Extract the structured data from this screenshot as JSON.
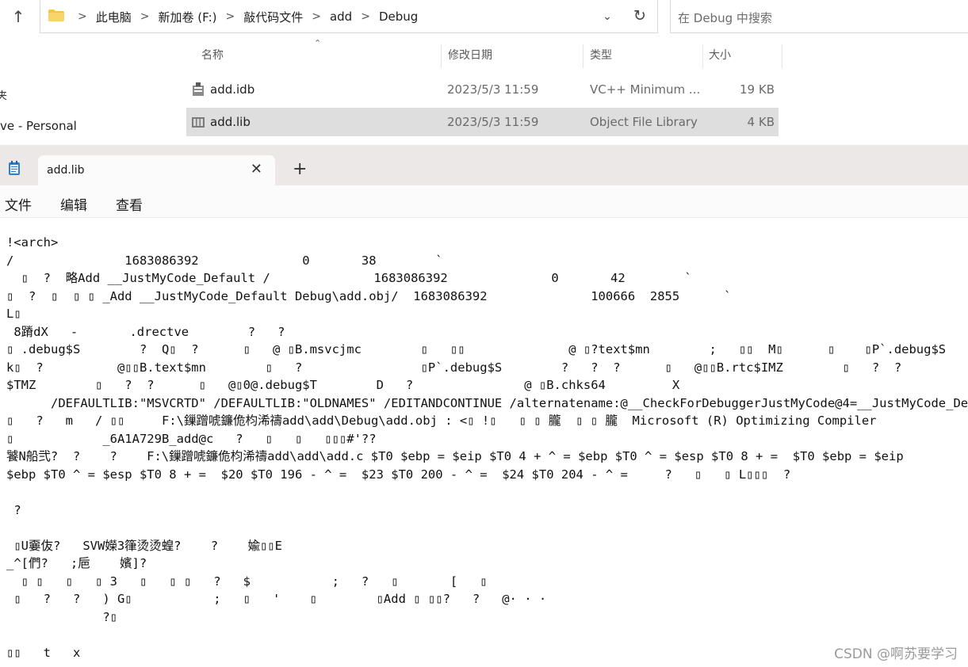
{
  "explorer": {
    "address": {
      "crumbs": [
        "此电脑",
        "新加卷 (F:)",
        "敲代码文件",
        "add",
        "Debug"
      ],
      "separator": ">"
    },
    "search_placeholder": "在 Debug 中搜索",
    "nav": {
      "fragment": "夹",
      "onedrive": "ve - Personal"
    },
    "columns": {
      "name": "名称",
      "date": "修改日期",
      "type": "类型",
      "size": "大小"
    },
    "files": [
      {
        "name": "add.idb",
        "date": "2023/5/3 11:59",
        "type": "VC++ Minimum ...",
        "size": "19 KB",
        "selected": false
      },
      {
        "name": "add.lib",
        "date": "2023/5/3 11:59",
        "type": "Object File Library",
        "size": "4 KB",
        "selected": true
      }
    ]
  },
  "notepad": {
    "tab_title": "add.lib",
    "menu": [
      "文件",
      "编辑",
      "查看"
    ],
    "lines": [
      "!<arch>",
      "/               1683086392              0       38        `",
      "  ▯  ?  略Add __JustMyCode_Default /              1683086392              0       42        `",
      "▯  ?  ▯  ▯ ▯ _Add __JustMyCode_Default Debug\\add.obj/  1683086392              100666  2855      `",
      "L▯",
      " 8蹐dX   -       .drectve        ?   ?",
      "▯ .debug$S        ?  Q▯  ?      ▯   @ ▯B.msvcjmc        ▯   ▯▯              @ ▯?text$mn        ;   ▯▯  M▯      ▯    ▯P`.debug$S",
      "k▯  ?          @▯▯B.text$mn        ▯   ?                ▯P`.debug$S        ?   ?  ?      ▯   @▯▯B.rtc$IMZ        ▯   ?  ?",
      "$TMZ        ▯   ?  ?      ▯   @▯0@.debug$T        D   ?               @ ▯B.chks64         X",
      "      /DEFAULTLIB:\"MSVCRTD\" /DEFAULTLIB:\"OLDNAMES\" /EDITANDCONTINUE /alternatename:@__CheckForDebuggerJustMyCode@4=__JustMyCode_Default",
      "▯   ?   m   / ▯▯     F:\\鏁蹭唬鐮佹枃浠禱add\\add\\Debug\\add.obj : <▯ !▯   ▯ ▯ 朧  ▯ ▯ 朧  Microsoft (R) Optimizing Compiler",
      "▯            _6A1A729B_add@c   ?   ▯   ▯   ▯▯▯#'??",
      "饕N船弐?  ?    ?    F:\\鏁蹭唬鐮佹枃浠禱add\\add\\add.c $T0 $ebp = $eip $T0 4 + ^ = $ebp $T0 ^ = $esp $T0 8 + =  $T0 $ebp = $eip",
      "$ebp $T0 ^ = $esp $T0 8 + =  $20 $T0 196 - ^ =  $23 $T0 200 - ^ =  $24 $T0 204 - ^ =     ?   ▯   ▯ L▯▯▯  ?",
      "",
      " ?",
      "",
      " ▯U嫑伖?   SVW嬫3箻烫烫蝗?    ?    婾▯▯E",
      "_^[們?   ;巵    嬪]?",
      "  ▯ ▯   ▯   ▯ 3   ▯   ▯ ▯   ?   $           ;   ?   ▯       [   ▯",
      " ▯   ?   ?   ) G▯           ;   ▯   '    ▯        ▯Add ▯ ▯▯?   ?   @· · ·",
      "             ?▯",
      "",
      "▯▯   t   x"
    ]
  },
  "watermark": "CSDN @啊苏要学习"
}
